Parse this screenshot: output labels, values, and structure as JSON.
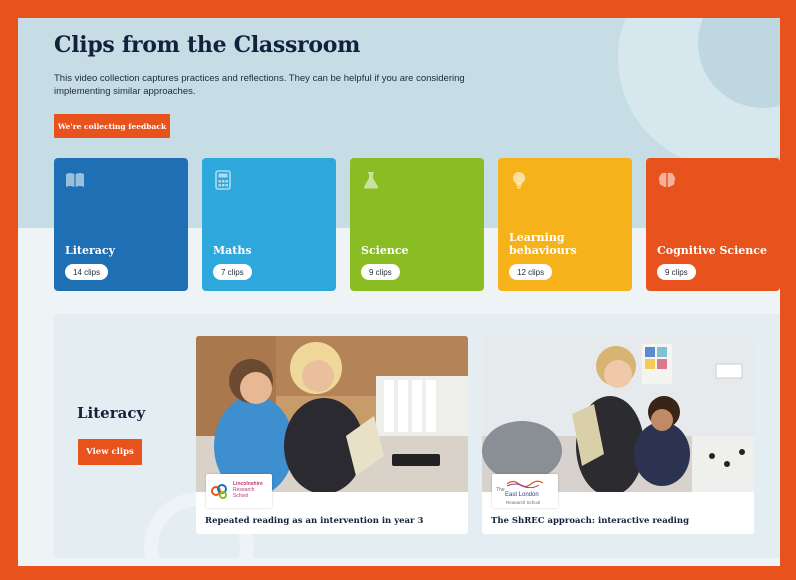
{
  "page": {
    "title": "Clips from the Classroom",
    "intro": "This video collection captures practices and reflections. They can be helpful if you are considering implementing similar approaches.",
    "feedback_button": "We're collecting feedback"
  },
  "categories": [
    {
      "label": "Literacy",
      "count": "14 clips",
      "color": "#1f6fb5",
      "icon": "book-icon"
    },
    {
      "label": "Maths",
      "count": "7 clips",
      "color": "#2ea7dd",
      "icon": "calculator-icon"
    },
    {
      "label": "Science",
      "count": "9 clips",
      "color": "#8abd24",
      "icon": "flask-icon"
    },
    {
      "label": "Learning behaviours",
      "count": "12 clips",
      "color": "#f6b21b",
      "icon": "lightbulb-icon"
    },
    {
      "label": "Cognitive Science",
      "count": "9 clips",
      "color": "#e8531d",
      "icon": "brain-icon"
    }
  ],
  "feature": {
    "title": "Literacy",
    "button": "View clips",
    "cards": [
      {
        "title": "Repeated reading as an intervention in year 3",
        "logo_line1": "Lincolnshire",
        "logo_line2": "Research",
        "logo_line3": "School"
      },
      {
        "title": "The ShREC approach: interactive reading",
        "logo_line1": "The",
        "logo_line2": "East London",
        "logo_line3": "Research School"
      }
    ]
  },
  "colors": {
    "accent": "#e8531d",
    "heading": "#14213d",
    "hero_bg": "#c6dde6"
  }
}
